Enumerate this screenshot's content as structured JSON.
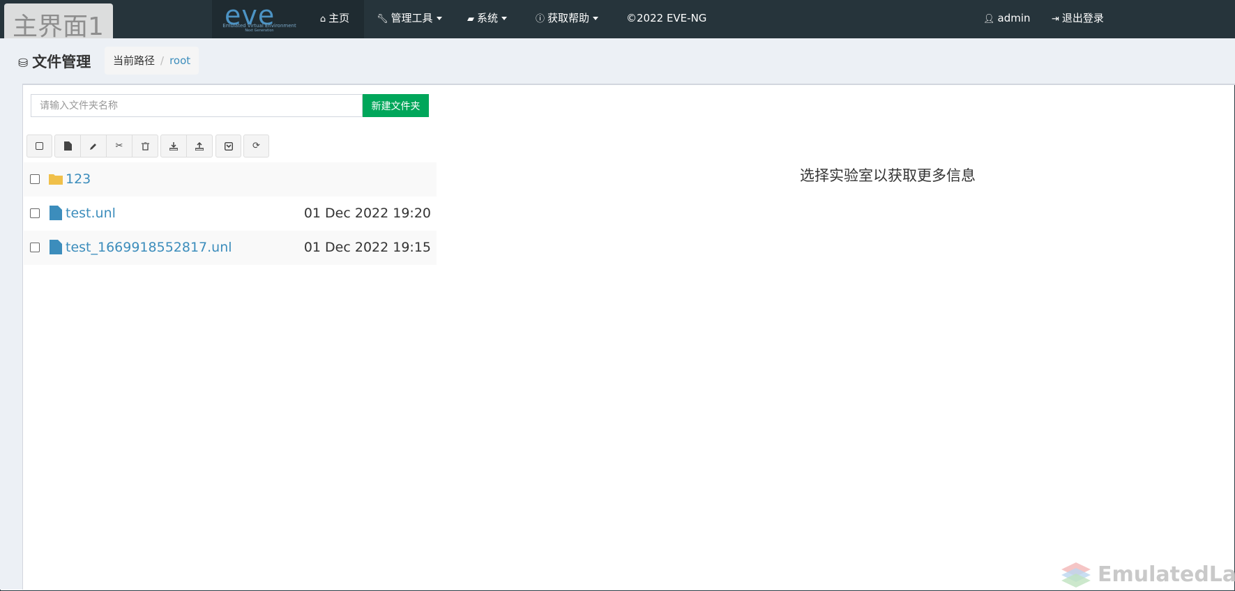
{
  "overlay": {
    "label": "主界面1"
  },
  "brand": {
    "logo": "eve",
    "sub1": "Emulated Virtual Environment",
    "sub2": "Next Generation"
  },
  "nav": {
    "home": "主页",
    "admin_tools": "管理工具",
    "system": "系统",
    "help": "获取帮助",
    "copyright": "©2022 EVE-NG",
    "user": "admin",
    "logout": "退出登录"
  },
  "page": {
    "title": "文件管理",
    "breadcrumb": {
      "label": "当前路径",
      "separator": "/",
      "current": "root"
    }
  },
  "folder_form": {
    "placeholder": "请输入文件夹名称",
    "button": "新建文件夹"
  },
  "toolbar": [
    {
      "name": "select-all",
      "icon": "checkbox-icon"
    },
    {
      "name": "new-lab",
      "icon": "file-icon"
    },
    {
      "name": "rename",
      "icon": "pencil-icon"
    },
    {
      "name": "move",
      "icon": "scissors-icon"
    },
    {
      "name": "delete",
      "icon": "trash-icon"
    },
    {
      "name": "import",
      "icon": "download-icon"
    },
    {
      "name": "export",
      "icon": "upload-icon"
    },
    {
      "name": "archive",
      "icon": "archive-icon"
    },
    {
      "name": "refresh",
      "icon": "refresh-icon"
    }
  ],
  "files": [
    {
      "type": "folder",
      "name": "123",
      "date": ""
    },
    {
      "type": "file",
      "name": "test.unl",
      "date": "01 Dec 2022 19:20"
    },
    {
      "type": "file",
      "name": "test_1669918552817.unl",
      "date": "01 Dec 2022 19:15"
    }
  ],
  "info": {
    "message": "选择实验室以获取更多信息"
  },
  "watermark": {
    "text": "EmulatedLab"
  },
  "colors": {
    "navbar": "#26343b",
    "accent": "#3c8dbc",
    "success": "#00a65a",
    "folder": "#f0c04a"
  }
}
